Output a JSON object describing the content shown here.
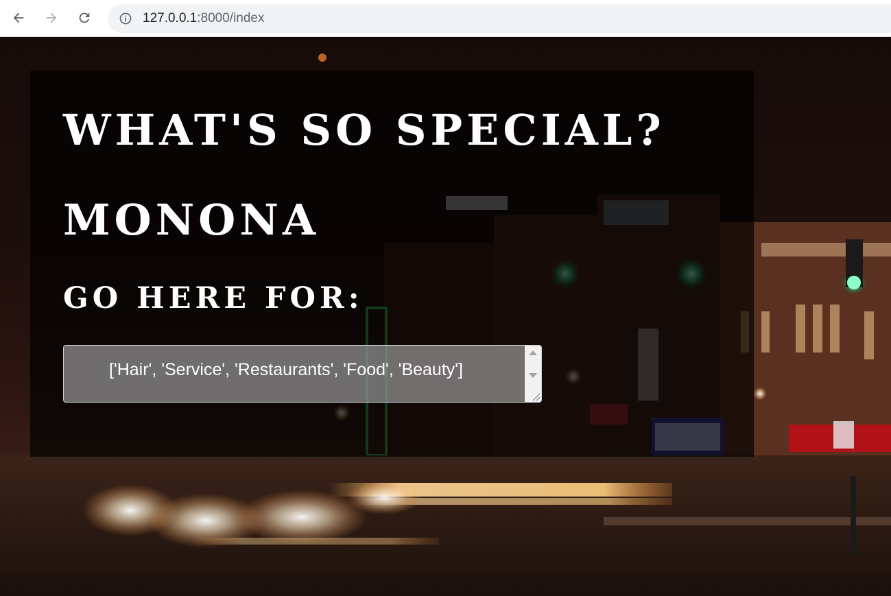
{
  "browser": {
    "url_host": "127.0.0.1",
    "url_path": ":8000/index",
    "icons": [
      "back-arrow-icon",
      "forward-arrow-icon",
      "reload-icon",
      "info-icon"
    ]
  },
  "page": {
    "heading": "WHAT'S SO SPECIAL?",
    "place": "MONONA",
    "subheading": "GO HERE FOR:",
    "result_text": "['Hair', 'Service', 'Restaurants', 'Food', 'Beauty']"
  },
  "colors": {
    "overlay": "#000000",
    "heading_text": "#ffffff",
    "result_box": "#969696"
  }
}
